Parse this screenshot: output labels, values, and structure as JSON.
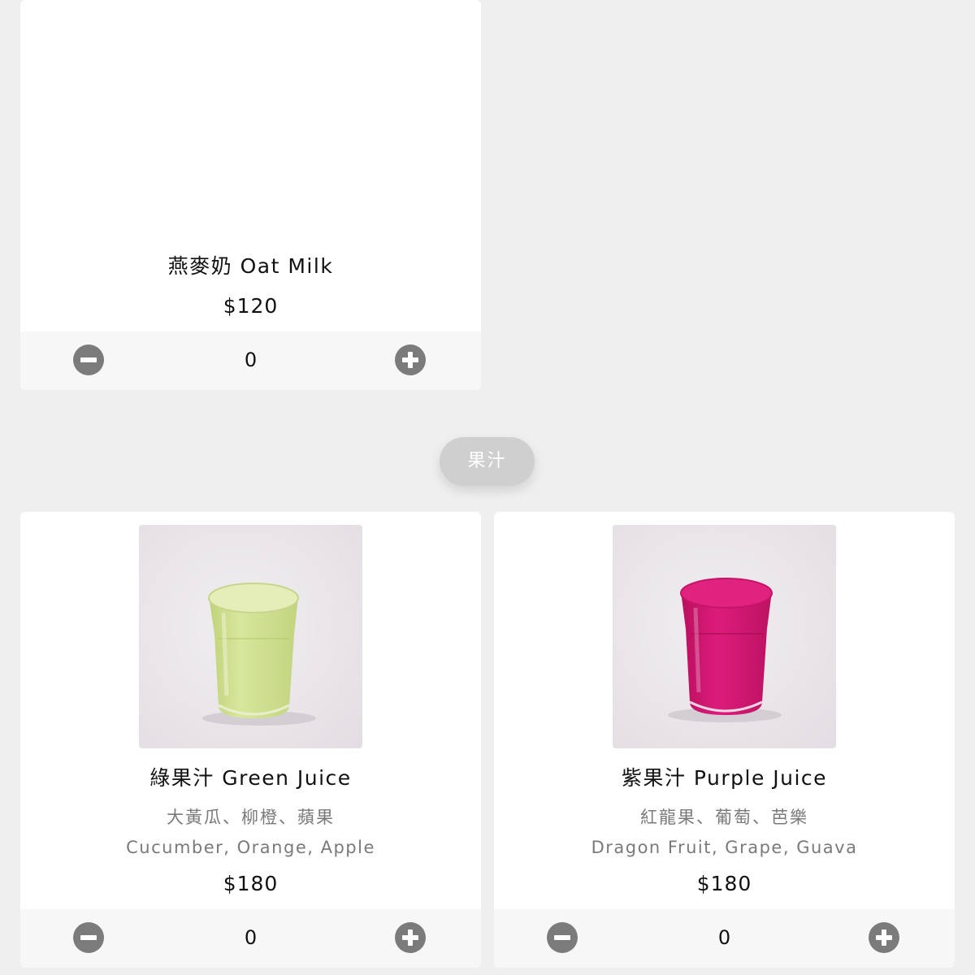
{
  "categories": {
    "juice_label": "果汁"
  },
  "products": [
    {
      "name": "燕麥奶 Oat Milk",
      "price": "$120",
      "quantity": "0"
    },
    {
      "name": "綠果汁 Green Juice",
      "ingredients_zh": "大黃瓜、柳橙、蘋果",
      "ingredients_en": "Cucumber, Orange, Apple",
      "price": "$180",
      "quantity": "0"
    },
    {
      "name": "紫果汁 Purple Juice",
      "ingredients_zh": "紅龍果、葡萄、芭樂",
      "ingredients_en": "Dragon Fruit, Grape, Guava",
      "price": "$180",
      "quantity": "0"
    }
  ],
  "icons": {
    "decrement": "minus-circle-icon",
    "increment": "plus-circle-icon"
  },
  "colors": {
    "page_background": "#efefef",
    "card_background": "#ffffff",
    "quantity_bar": "#f7f7f7",
    "stepper_icon": "#7b7b7b",
    "category_pill": "#cfcfcf",
    "green_juice": "#cfe08c",
    "purple_juice": "#d31672"
  }
}
